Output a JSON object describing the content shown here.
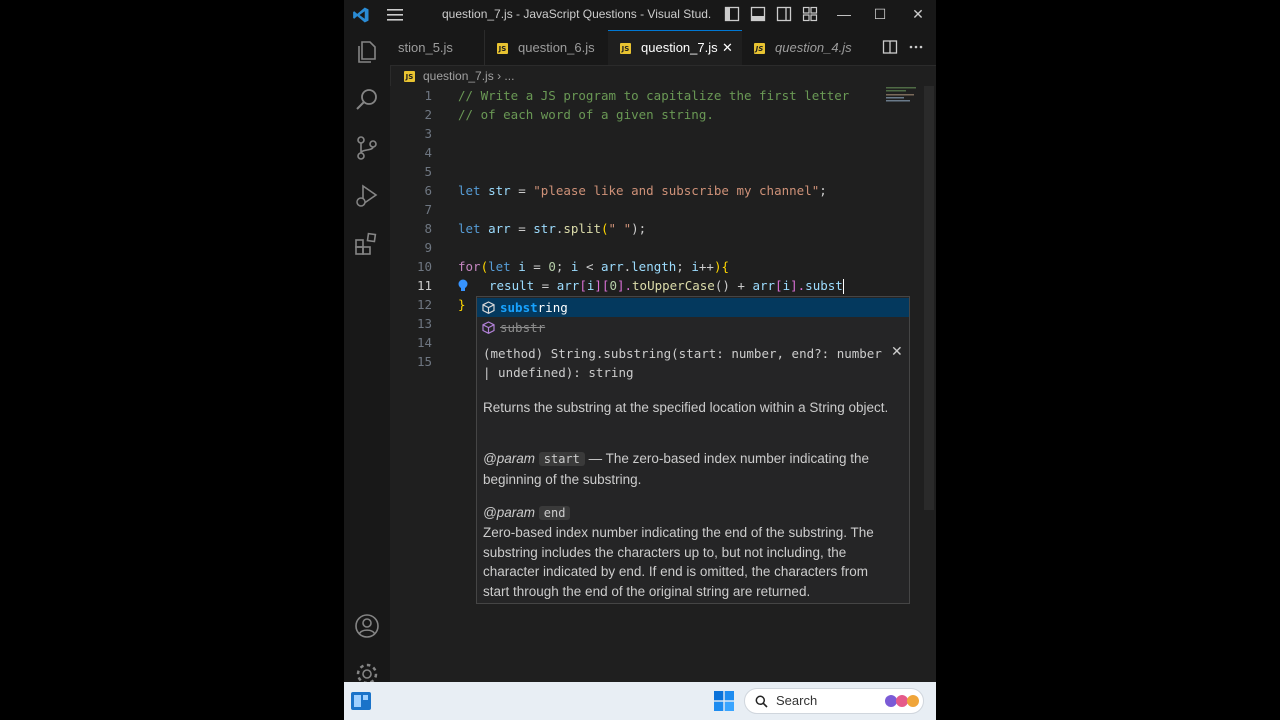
{
  "window": {
    "title": "question_7.js - JavaScript Questions - Visual Stud...",
    "controls": {
      "minimize": "—",
      "maximize": "☐",
      "close": "✕"
    }
  },
  "tabs": [
    {
      "label": "stion_5.js",
      "active": false
    },
    {
      "label": "question_6.js",
      "active": false
    },
    {
      "label": "question_7.js",
      "active": true,
      "close": "✕"
    },
    {
      "label": "question_4.js",
      "active": false
    }
  ],
  "js_badge": "JS",
  "breadcrumb": {
    "file": "question_7.js",
    "separator": "›",
    "rest": "..."
  },
  "editor": {
    "current_line": 11,
    "lines": [
      {
        "n": "1"
      },
      {
        "n": "2"
      },
      {
        "n": "3"
      },
      {
        "n": "4"
      },
      {
        "n": "5"
      },
      {
        "n": "6"
      },
      {
        "n": "7"
      },
      {
        "n": "8"
      },
      {
        "n": "9"
      },
      {
        "n": "10"
      },
      {
        "n": "11"
      },
      {
        "n": "12"
      },
      {
        "n": "13"
      },
      {
        "n": "14"
      },
      {
        "n": "15"
      }
    ],
    "code": {
      "l1": "// Write a JS program to capitalize the first letter",
      "l2": "// of each word of a given string.",
      "l6_let": "let",
      "l6_var": "str",
      "l6_eq": " = ",
      "l6_str": "\"please like and subscribe my channel\"",
      "l6_semi": ";",
      "l8_let": "let",
      "l8_var": "arr",
      "l8_eq": " = ",
      "l8_obj": "str",
      "l8_dot": ".",
      "l8_fn": "split",
      "l8_open": "(",
      "l8_str": "\" \"",
      "l8_close": ");",
      "l10_for": "for",
      "l10_open": "(",
      "l10_let": "let",
      "l10_i": "i",
      "l10_eq": " = ",
      "l10_zero": "0",
      "l10_semi1": "; ",
      "l10_i2": "i",
      "l10_lt": " < ",
      "l10_arr": "arr",
      "l10_dot": ".",
      "l10_len": "length",
      "l10_semi2": "; ",
      "l10_i3": "i",
      "l10_inc": "++",
      "l10_close": ")",
      "l10_brace": "{",
      "l11_result": "result",
      "l11_eq": " = ",
      "l11_arr": "arr",
      "l11_b1": "[",
      "l11_i": "i",
      "l11_b2": "][",
      "l11_zero": "0",
      "l11_b3": "].",
      "l11_fn": "toUpperCase",
      "l11_call": "() + ",
      "l11_arr2": "arr",
      "l11_b4": "[",
      "l11_i2": "i",
      "l11_b5": "].",
      "l11_subst": "subst",
      "l12": "}"
    }
  },
  "suggestions": [
    {
      "match": "subst",
      "rest": "ring",
      "selected": true
    },
    {
      "match": "",
      "rest": "substr",
      "deprecated": true
    }
  ],
  "docs": {
    "signature": "(method) String.substring(start: number, end?: number | undefined): string",
    "close": "✕",
    "summary": "Returns the substring at the specified location within a String object.",
    "param1_tag": "@param",
    "param1_name": "start",
    "param1_desc": " — The zero-based index number indicating the beginning of the substring.",
    "param2_tag": "@param",
    "param2_name": "end",
    "param2_desc": "Zero-based index number indicating the end of the substring. The substring includes the characters up to, but not including, the character indicated by end. If end is omitted, the characters from start through the end of the original string are returned."
  },
  "taskbar": {
    "search_label": "Search"
  },
  "colors": {
    "accent": "#0078d4",
    "editor_bg": "#1f1f1f",
    "js_yellow": "#e8c331",
    "suggest_highlight": "#18a3ff"
  }
}
